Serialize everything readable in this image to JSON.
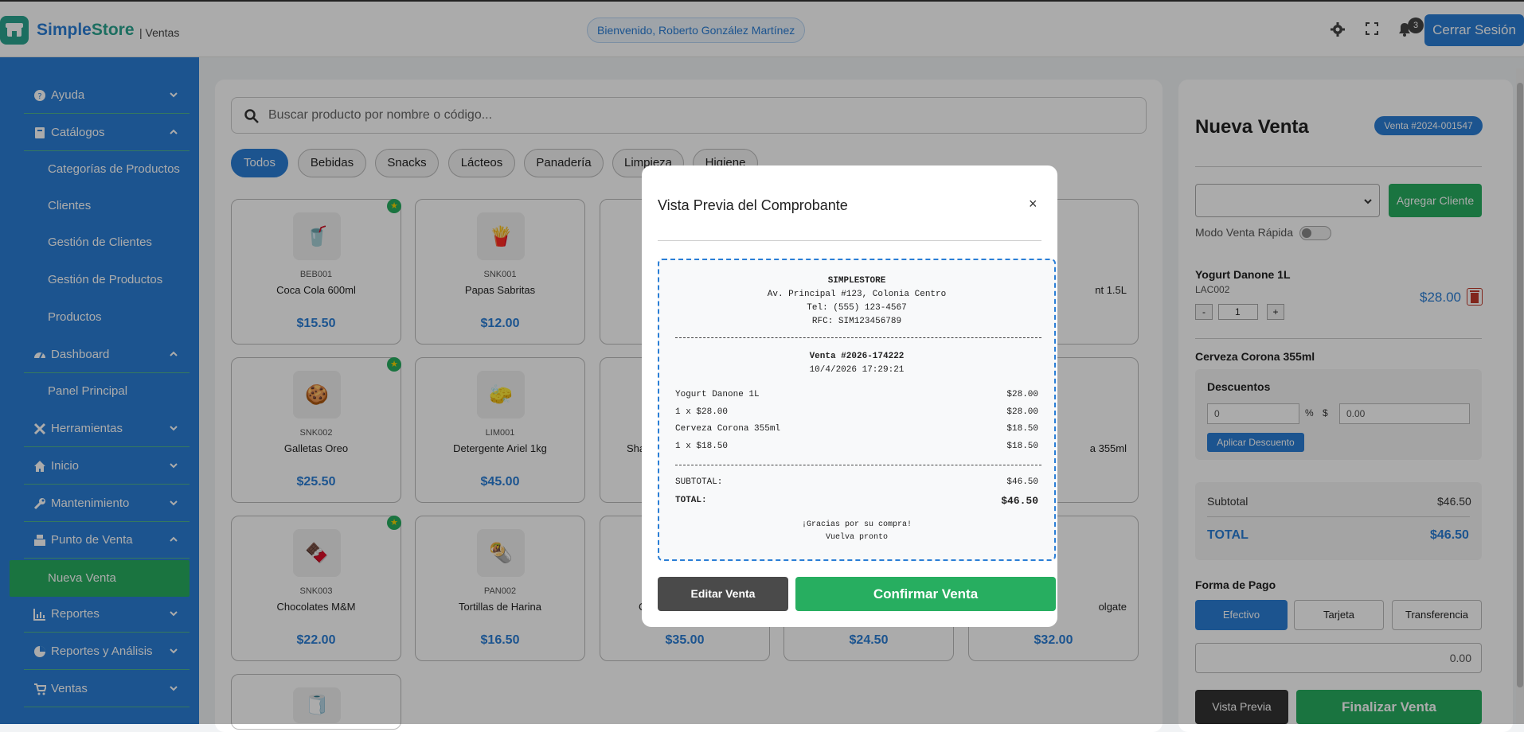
{
  "header": {
    "brand_part1": "Simple",
    "brand_part2": "Store",
    "brand_sub": "| Ventas",
    "welcome": "Bienvenido, Roberto González Martínez",
    "notification_count": "3",
    "logout_label": "Cerrar Sesión",
    "icons": [
      "store-icon",
      "gear-icon",
      "fullscreen-icon",
      "bell-icon"
    ]
  },
  "sidebar": {
    "items": [
      {
        "label": "Ayuda",
        "icon": "help-icon",
        "expanded": false
      },
      {
        "label": "Catálogos",
        "icon": "book-icon",
        "expanded": true
      },
      {
        "label": "Categorías de Productos"
      },
      {
        "label": "Clientes"
      },
      {
        "label": "Gestión de Clientes"
      },
      {
        "label": "Gestión de Productos"
      },
      {
        "label": "Productos"
      },
      {
        "label": "Dashboard",
        "icon": "gauge-icon",
        "expanded": true
      },
      {
        "label": "Panel Principal"
      },
      {
        "label": "Herramientas",
        "icon": "tools-icon",
        "expanded": false
      },
      {
        "label": "Inicio",
        "icon": "home-icon",
        "expanded": false
      },
      {
        "label": "Mantenimiento",
        "icon": "wrench-icon",
        "expanded": false
      },
      {
        "label": "Punto de Venta",
        "icon": "register-icon",
        "expanded": true
      },
      {
        "label": "Nueva Venta",
        "active": true
      },
      {
        "label": "Reportes",
        "icon": "chart-icon",
        "expanded": false
      },
      {
        "label": "Reportes y Análisis",
        "icon": "pie-icon",
        "expanded": false
      },
      {
        "label": "Ventas",
        "icon": "cart-icon",
        "expanded": false
      }
    ]
  },
  "products": {
    "search_placeholder": "Buscar producto por nombre o código...",
    "categories": [
      "Todos",
      "Bebidas",
      "Snacks",
      "Lácteos",
      "Panadería",
      "Limpieza",
      "Higiene"
    ],
    "active_category": "Todos",
    "cards": [
      {
        "code": "BEB001",
        "name": "Coca Cola 600ml",
        "price": "$15.50",
        "favorite": true,
        "icon": "🥤"
      },
      {
        "code": "SNK001",
        "name": "Papas Sabritas",
        "price": "$12.00",
        "favorite": false,
        "icon": "🍟"
      },
      {
        "code": "",
        "name": "",
        "price": "",
        "favorite": false,
        "icon": ""
      },
      {
        "code": "",
        "name": "",
        "price": "",
        "favorite": false,
        "icon": ""
      },
      {
        "code": "",
        "name": "nt 1.5L",
        "price": "",
        "favorite": false,
        "icon": ""
      },
      {
        "code": "SNK002",
        "name": "Galletas Oreo",
        "price": "$25.50",
        "favorite": true,
        "icon": "🍪"
      },
      {
        "code": "LIM001",
        "name": "Detergente Ariel 1kg",
        "price": "$45.00",
        "favorite": false,
        "icon": "🧽"
      },
      {
        "code": "",
        "name": "Sha",
        "price": "",
        "favorite": false,
        "icon": ""
      },
      {
        "code": "",
        "name": "",
        "price": "",
        "favorite": false,
        "icon": ""
      },
      {
        "code": "",
        "name": "a 355ml",
        "price": "",
        "favorite": false,
        "icon": ""
      },
      {
        "code": "SNK003",
        "name": "Chocolates M&M",
        "price": "$22.00",
        "favorite": true,
        "icon": "🍫"
      },
      {
        "code": "PAN002",
        "name": "Tortillas de Harina",
        "price": "$16.50",
        "favorite": false,
        "icon": "🌯"
      },
      {
        "code": "",
        "name": "C",
        "price": "$35.00",
        "favorite": false,
        "icon": ""
      },
      {
        "code": "",
        "name": "",
        "price": "$24.50",
        "favorite": false,
        "icon": ""
      },
      {
        "code": "",
        "name": "olgate",
        "price": "$32.00",
        "favorite": false,
        "icon": ""
      },
      {
        "code": "",
        "name": "",
        "price": "",
        "favorite": false,
        "icon": "🧻"
      }
    ]
  },
  "sale": {
    "title": "Nueva Venta",
    "sale_badge": "Venta #2024-001547",
    "add_client_label": "Agregar Cliente",
    "quick_mode_label": "Modo Venta Rápida",
    "cart": [
      {
        "name": "Yogurt Danone 1L",
        "code": "LAC002",
        "qty": "1",
        "price": "$28.00"
      },
      {
        "name": "Cerveza Corona 355ml"
      }
    ],
    "discounts": {
      "title": "Descuentos",
      "percent_value": "0",
      "percent_symbol": "%",
      "amount_symbol": "$",
      "amount_placeholder": "0.00",
      "apply_label": "Aplicar Descuento"
    },
    "subtotal_label": "Subtotal",
    "subtotal_value": "$46.50",
    "total_label": "TOTAL",
    "total_value": "$46.50",
    "payment_title": "Forma de Pago",
    "payment_methods": [
      "Efectivo",
      "Tarjeta",
      "Transferencia"
    ],
    "active_payment": "Efectivo",
    "amount_placeholder": "0.00",
    "preview_label": "Vista Previa",
    "finalize_label": "Finalizar Venta"
  },
  "modal": {
    "title": "Vista Previa del Comprobante",
    "close": "×",
    "receipt": {
      "store": "SIMPLESTORE",
      "address": "Av. Principal #123, Colonia Centro",
      "phone": "Tel: (555) 123-4567",
      "rfc": "RFC: SIM123456789",
      "sale_number": "Venta #2026-174222",
      "datetime": "10/4/2026 17:29:21",
      "lines": [
        {
          "left": "Yogurt Danone 1L",
          "right": "$28.00"
        },
        {
          "left": "1 x $28.00",
          "right": "$28.00"
        },
        {
          "left": "Cerveza Corona 355ml",
          "right": "$18.50"
        },
        {
          "left": "1 x $18.50",
          "right": "$18.50"
        }
      ],
      "subtotal_label": "SUBTOTAL:",
      "subtotal_value": "$46.50",
      "total_label": "TOTAL:",
      "total_value": "$46.50",
      "thanks": "¡Gracias por su compra!",
      "farewell": "Vuelva pronto"
    },
    "edit_label": "Editar Venta",
    "confirm_label": "Confirmar Venta"
  },
  "colors": {
    "primary": "#2a7ed6",
    "success": "#27ae60",
    "dark": "#333333"
  }
}
